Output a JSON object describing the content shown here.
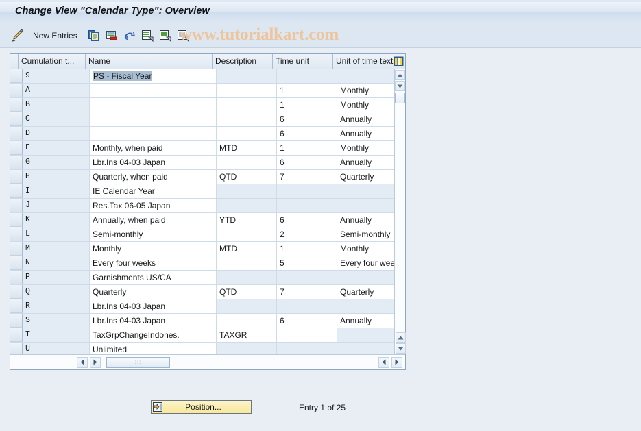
{
  "window": {
    "title": "Change View \"Calendar Type\": Overview"
  },
  "watermark": {
    "text": "www.tutorialkart.com"
  },
  "toolbar": {
    "new_entries_label": "New Entries",
    "icons": [
      {
        "name": "pencil-icon",
        "title": "Display/Change"
      },
      {
        "name": "copy-icon",
        "title": "Copy As"
      },
      {
        "name": "delete-icon",
        "title": "Delete"
      },
      {
        "name": "undo-icon",
        "title": "Undo Change"
      },
      {
        "name": "select-all-icon",
        "title": "Select All"
      },
      {
        "name": "deselect-all-icon",
        "title": "Deselect All"
      },
      {
        "name": "details-icon",
        "title": "Details"
      }
    ]
  },
  "grid": {
    "columns": [
      {
        "key": "cumulation_type",
        "label": "Cumulation t..."
      },
      {
        "key": "name",
        "label": "Name"
      },
      {
        "key": "description",
        "label": "Description"
      },
      {
        "key": "time_unit",
        "label": "Time unit"
      },
      {
        "key": "unit_of_time_text",
        "label": "Unit of time text"
      }
    ],
    "config_icon": "table-settings-icon",
    "rows": [
      {
        "cumulation_type": "9",
        "name": "PS - Fiscal Year",
        "description": "",
        "time_unit": "",
        "unit_of_time_text": "",
        "selected_text": true
      },
      {
        "cumulation_type": "A",
        "name": "",
        "description": "",
        "time_unit": "1",
        "unit_of_time_text": "Monthly"
      },
      {
        "cumulation_type": "B",
        "name": "",
        "description": "",
        "time_unit": "1",
        "unit_of_time_text": "Monthly"
      },
      {
        "cumulation_type": "C",
        "name": "",
        "description": "",
        "time_unit": "6",
        "unit_of_time_text": "Annually"
      },
      {
        "cumulation_type": "D",
        "name": "",
        "description": "",
        "time_unit": "6",
        "unit_of_time_text": "Annually"
      },
      {
        "cumulation_type": "F",
        "name": "Monthly, when paid",
        "description": "MTD",
        "time_unit": "1",
        "unit_of_time_text": "Monthly"
      },
      {
        "cumulation_type": "G",
        "name": "Lbr.Ins 04-03  Japan",
        "description": "",
        "time_unit": "6",
        "unit_of_time_text": "Annually"
      },
      {
        "cumulation_type": "H",
        "name": "Quarterly, when paid",
        "description": "QTD",
        "time_unit": "7",
        "unit_of_time_text": "Quarterly"
      },
      {
        "cumulation_type": "I",
        "name": "IE Calendar Year",
        "description": "",
        "time_unit": "",
        "unit_of_time_text": ""
      },
      {
        "cumulation_type": "J",
        "name": "Res.Tax 06-05  Japan",
        "description": "",
        "time_unit": "",
        "unit_of_time_text": ""
      },
      {
        "cumulation_type": "K",
        "name": "Annually, when paid",
        "description": "YTD",
        "time_unit": "6",
        "unit_of_time_text": "Annually"
      },
      {
        "cumulation_type": "L",
        "name": "Semi-monthly",
        "description": "",
        "time_unit": "2",
        "unit_of_time_text": "Semi-monthly"
      },
      {
        "cumulation_type": "M",
        "name": "Monthly",
        "description": "MTD",
        "time_unit": "1",
        "unit_of_time_text": "Monthly"
      },
      {
        "cumulation_type": "N",
        "name": "Every four weeks",
        "description": "",
        "time_unit": "5",
        "unit_of_time_text": "Every four weeks"
      },
      {
        "cumulation_type": "P",
        "name": "Garnishments US/CA",
        "description": "",
        "time_unit": "",
        "unit_of_time_text": ""
      },
      {
        "cumulation_type": "Q",
        "name": "Quarterly",
        "description": "QTD",
        "time_unit": "7",
        "unit_of_time_text": "Quarterly"
      },
      {
        "cumulation_type": "R",
        "name": "Lbr.Ins 04-03  Japan",
        "description": "",
        "time_unit": "",
        "unit_of_time_text": ""
      },
      {
        "cumulation_type": "S",
        "name": "Lbr.Ins 04-03  Japan",
        "description": "",
        "time_unit": "6",
        "unit_of_time_text": "Annually"
      },
      {
        "cumulation_type": "T",
        "name": "TaxGrpChangeIndones.",
        "description": "TAXGR",
        "time_unit": "",
        "unit_of_time_text": ""
      },
      {
        "cumulation_type": "U",
        "name": "Unlimited",
        "description": "",
        "time_unit": "",
        "unit_of_time_text": ""
      }
    ]
  },
  "footer": {
    "position_label": "Position...",
    "entry_status": "Entry 1 of 25"
  },
  "colors": {
    "background": "#e9eef5",
    "titlebar": "#dce6f2",
    "toolbar": "#dde7f1",
    "grid_border": "#8ba7c2",
    "cell_tint": "#e3ecf5",
    "selection": "#a9bdd1",
    "watermark": "#eec49c",
    "button_yellow": "#f7e89a"
  }
}
